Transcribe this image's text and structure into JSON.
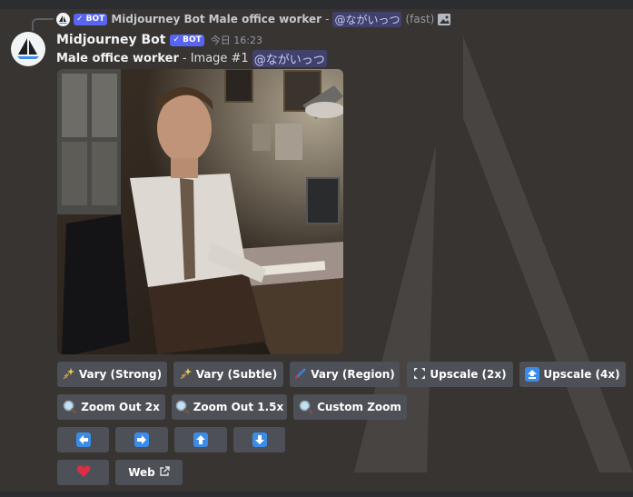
{
  "reply": {
    "bot_name": "Midjourney Bot",
    "badge": "✓ BOT",
    "prompt": "Male office worker",
    "dash": "-",
    "mention": "@ながいっつ",
    "speed": "(fast)"
  },
  "message": {
    "bot_name": "Midjourney Bot",
    "badge": "✓ BOT",
    "timestamp": "今日 16:23",
    "prompt": "Male office worker",
    "image_label": "- Image #1",
    "mention": "@ながいっつ"
  },
  "buttons": {
    "vary_strong": "Vary (Strong)",
    "vary_subtle": "Vary (Subtle)",
    "vary_region": "Vary (Region)",
    "upscale_2x": "Upscale (2x)",
    "upscale_4x": "Upscale (4x)",
    "zoom_out_2x": "Zoom Out 2x",
    "zoom_out_1_5x": "Zoom Out 1.5x",
    "custom_zoom": "Custom Zoom",
    "web": "Web"
  },
  "icons": {
    "sparkles": "sparkles-icon",
    "paintbrush": "paintbrush-icon",
    "expand": "expand-icon",
    "up_arrow": "up-arrow-icon",
    "magnifier": "magnifier-icon",
    "arrow_left": "arrow-left-icon",
    "arrow_right": "arrow-right-icon",
    "arrow_up": "arrow-up-icon",
    "arrow_down": "arrow-down-icon",
    "heart": "heart-icon",
    "external_link": "external-link-icon"
  },
  "colors": {
    "background": "#373431",
    "button": "#4e5058",
    "bot_badge": "#5865f2",
    "mention_bg": "rgba(88,101,242,0.3)",
    "arrow_blue": "#3c8ce7",
    "heart_red": "#dd2e44"
  }
}
